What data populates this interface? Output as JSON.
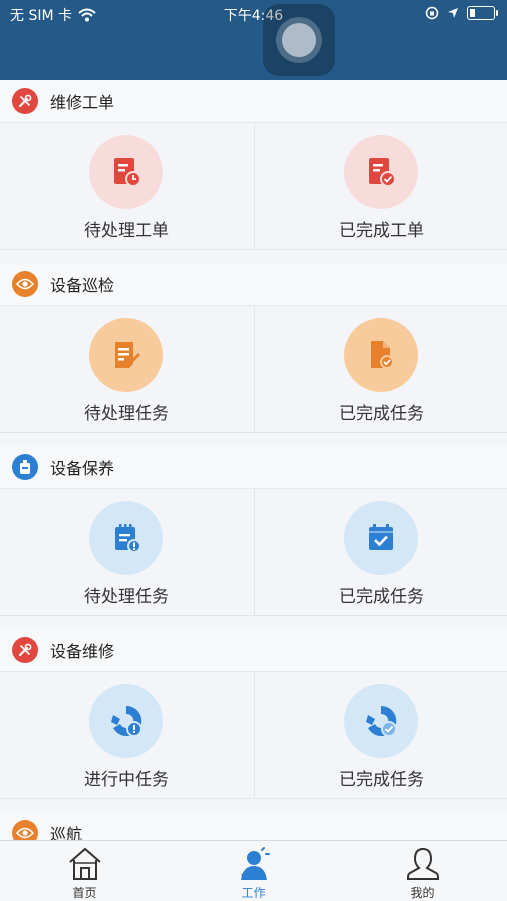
{
  "status_bar": {
    "carrier": "无 SIM 卡",
    "time": "下午4:46"
  },
  "sections": [
    {
      "title": "维修工单",
      "icon": "wrench-icon",
      "items": [
        {
          "label": "待处理工单",
          "icon": "pending-workorder-icon"
        },
        {
          "label": "已完成工单",
          "icon": "completed-workorder-icon"
        }
      ]
    },
    {
      "title": "设备巡检",
      "icon": "eye-icon",
      "items": [
        {
          "label": "待处理任务",
          "icon": "pending-inspection-icon"
        },
        {
          "label": "已完成任务",
          "icon": "completed-inspection-icon"
        }
      ]
    },
    {
      "title": "设备保养",
      "icon": "maintenance-icon",
      "items": [
        {
          "label": "待处理任务",
          "icon": "pending-maintenance-icon"
        },
        {
          "label": "已完成任务",
          "icon": "completed-maintenance-icon"
        }
      ]
    },
    {
      "title": "设备维修",
      "icon": "wrench-icon",
      "items": [
        {
          "label": "进行中任务",
          "icon": "in-progress-repair-icon"
        },
        {
          "label": "已完成任务",
          "icon": "completed-repair-icon"
        }
      ]
    },
    {
      "title": "巡航",
      "icon": "eye-icon"
    }
  ],
  "tabbar": [
    {
      "label": "首页",
      "icon": "home-icon"
    },
    {
      "label": "工作",
      "icon": "work-icon",
      "active": true
    },
    {
      "label": "我的",
      "icon": "profile-icon"
    }
  ],
  "colors": {
    "header": "#255a88",
    "red": "#e0483f",
    "orange": "#e8812c",
    "blue": "#2d7fd3",
    "red_bg": "#f8dcdc",
    "orange_bg": "#f8cb9d",
    "blue_bg": "#d3e7f6"
  }
}
